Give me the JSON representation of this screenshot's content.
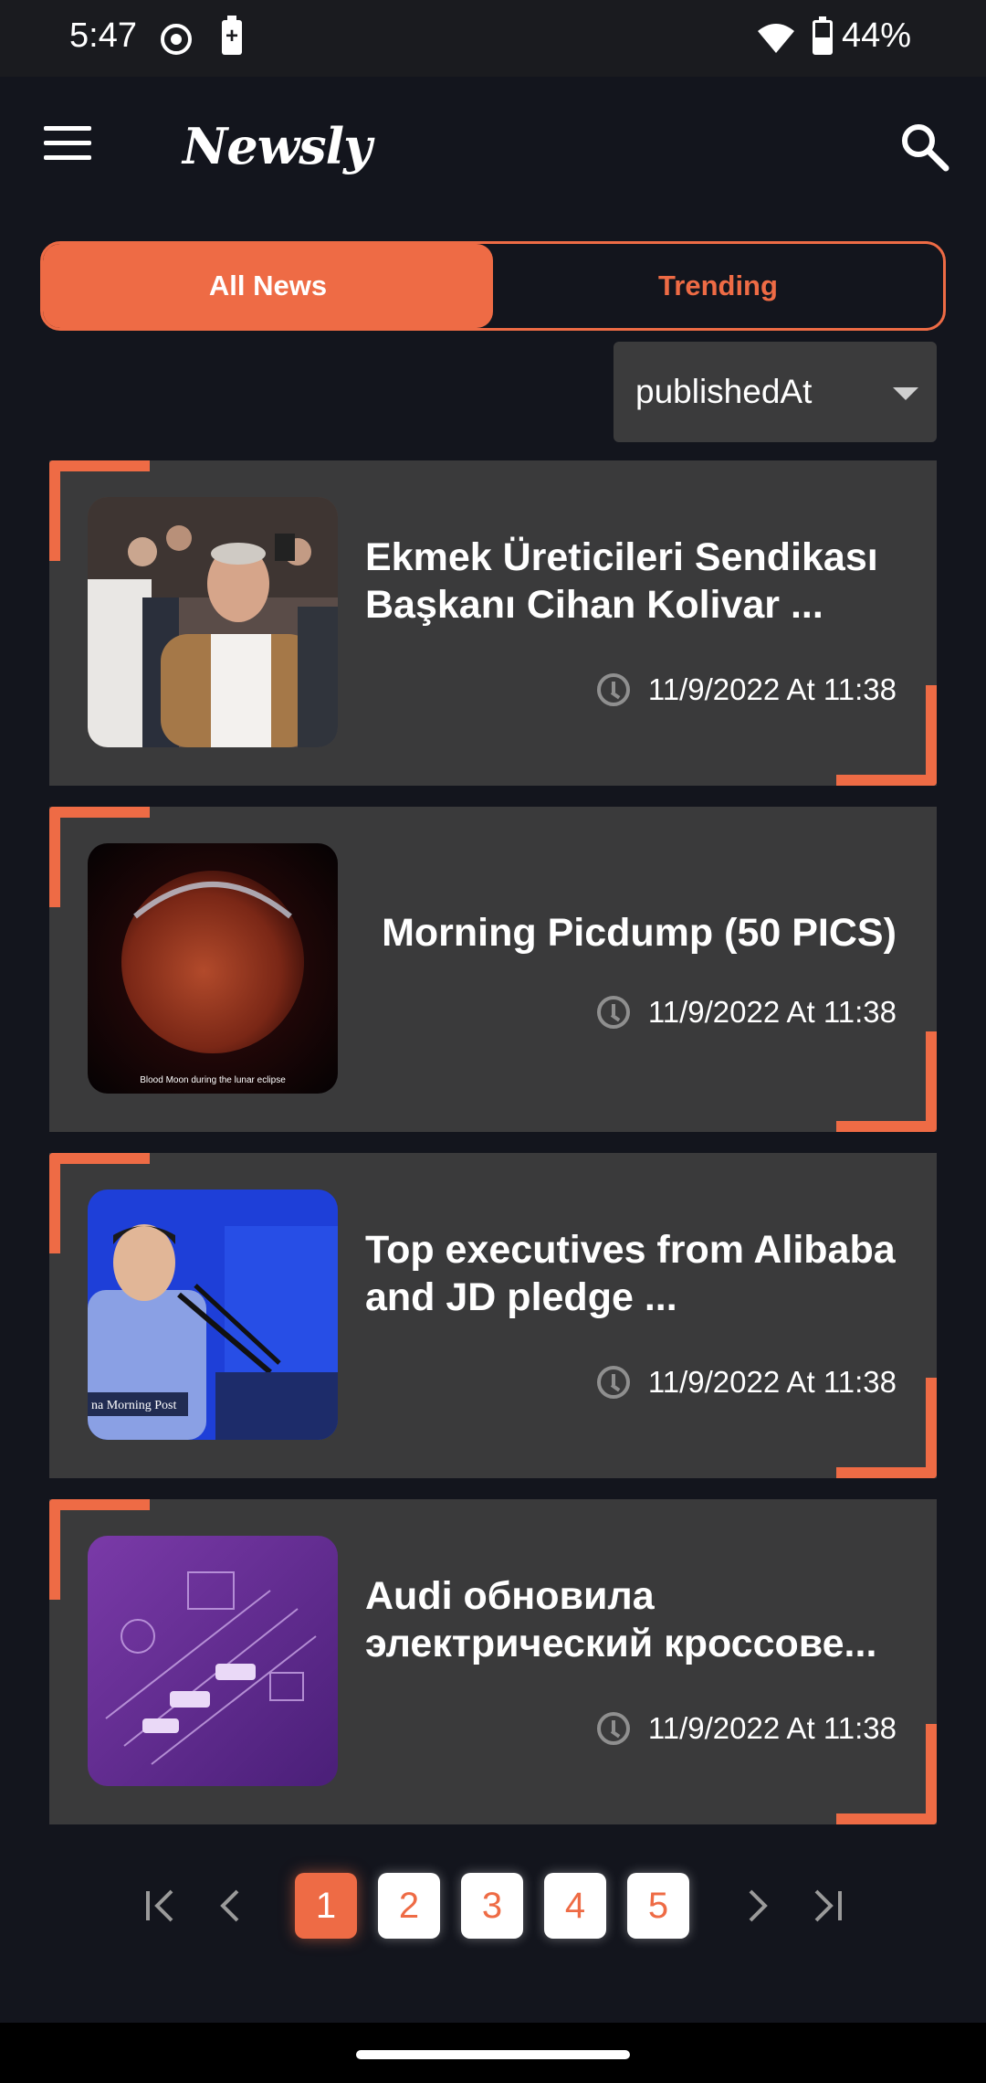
{
  "status_bar": {
    "time": "5:47",
    "battery_percent": "44%",
    "battery_level": 0.44,
    "icons": [
      "screen-record-icon",
      "battery-saver-icon",
      "wifi-icon",
      "battery-icon"
    ]
  },
  "app_bar": {
    "brand": "Newsly",
    "icons": [
      "menu-icon",
      "search-icon"
    ]
  },
  "tabs": [
    {
      "label": "All News",
      "active": true
    },
    {
      "label": "Trending",
      "active": false
    }
  ],
  "sort": {
    "value": "publishedAt"
  },
  "articles": [
    {
      "title": "Ekmek Üreticileri Sendikası Başkanı Cihan Kolivar ...",
      "date": "11/9/2022 At 11:38",
      "image": "news-photo-crowd"
    },
    {
      "title": "Morning Picdump (50 PICS)",
      "date": "11/9/2022 At 11:38",
      "image": "blood-moon-photo",
      "image_caption": "Blood Moon during the lunar eclipse"
    },
    {
      "title": "Top executives from Alibaba and JD pledge ...",
      "date": "11/9/2022 At 11:38",
      "image": "speaker-podium-photo",
      "image_caption": "na Morning Post"
    },
    {
      "title": "Audi обновила электрический кроссове...",
      "date": "11/9/2022 At 11:38",
      "image": "purple-tech-illustration"
    }
  ],
  "pagination": {
    "pages": [
      "1",
      "2",
      "3",
      "4",
      "5"
    ],
    "current": "1",
    "icons": [
      "first-page-icon",
      "prev-page-icon",
      "next-page-icon",
      "last-page-icon"
    ]
  },
  "colors": {
    "accent": "#ee6b45",
    "background": "#13151d",
    "card": "#3a3a3b"
  }
}
